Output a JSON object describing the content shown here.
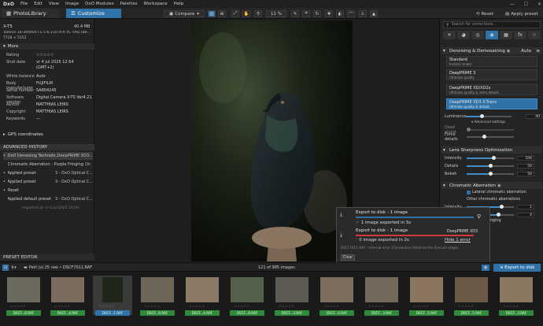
{
  "app": {
    "logo": "DxO",
    "menus": [
      "File",
      "Edit",
      "View",
      "Image",
      "DxO Modules",
      "Palettes",
      "Workspace",
      "Help"
    ]
  },
  "toolbar": {
    "tab_photolibrary": "PhotoLibrary",
    "tab_customize": "Customize",
    "compare_label": "Compare",
    "zoom_value": "11 %",
    "reset_label": "Reset",
    "apply_preset_label": "Apply preset"
  },
  "info": {
    "camera_line1": "X-T5",
    "file_size": "40.4 MB",
    "lens_line": "Tamron 18-300mm F3.5-6.3 Di III-A VC VXD (B0...",
    "dimensions": "7728 × 5152",
    "more_label": "More",
    "rows": [
      {
        "k": "Rating",
        "v": "☆☆☆☆☆"
      },
      {
        "k": "Shot date",
        "v": "vr 4 jul 2025 12:54"
      },
      {
        "k": "",
        "v": "(GMT+2)"
      },
      {
        "k": "White balance",
        "v": "Auto"
      },
      {
        "k": "Body manufacturer",
        "v": "FUJIFILM"
      },
      {
        "k": "Serial number",
        "v": "5A804245"
      },
      {
        "k": "Software version",
        "v": "Digital Camera X-T5 Ver4.21"
      },
      {
        "k": "Author",
        "v": "MATTHIAS LEIRS"
      },
      {
        "k": "Copyright",
        "v": "MATTHIAS LEIRS"
      },
      {
        "k": "Keywords",
        "v": "—"
      }
    ],
    "gps_label": "GPS coordinates"
  },
  "history": {
    "title": "ADVANCED HISTORY",
    "items": [
      {
        "n": "DxO Denoising Technolo...",
        "d": "DeepPRIME XD3..."
      },
      {
        "n": "Chromatic Aberration - Purple Fringing",
        "d": "On"
      },
      {
        "n": "Applied preset",
        "d": "3 - DxO Optical C..."
      },
      {
        "n": "Applied preset",
        "d": "3 - DxO Optical C..."
      },
      {
        "n": "Reset",
        "d": ""
      },
      {
        "n": "Applied default preset",
        "d": "3 - DxO Optical C..."
      }
    ],
    "imported": "Imported on vr 4 jul 2025 23:00"
  },
  "right": {
    "search_placeholder": "Search for corrections...",
    "denoise": {
      "title": "Denoising & Demosaicing",
      "auto": "Auto",
      "options": [
        {
          "t": "Standard",
          "s": "Instant render"
        },
        {
          "t": "DeepPRIME 3",
          "s": "Ultimate quality"
        },
        {
          "t": "DeepPRIME XD/XD2s",
          "s": "Ultimate quality & extra details"
        },
        {
          "t": "DeepPRIME XD3 X-Trans",
          "s": "Ultimate quality & details"
        }
      ],
      "luminance_label": "Luminance",
      "luminance_value": "40",
      "advanced_label": "Advanced settings",
      "dead_pixels_label": "Dead pixels",
      "force_details_label": "Force details"
    },
    "lens": {
      "title": "Lens Sharpness Optimization",
      "rows": [
        {
          "lbl": "Intensity",
          "val": "100",
          "frac": 0.55
        },
        {
          "lbl": "Details",
          "val": "50",
          "frac": 0.5
        },
        {
          "lbl": "Bokeh",
          "val": "50",
          "frac": 0.5
        }
      ]
    },
    "chroma": {
      "title": "Chromatic Aberration",
      "lateral": "Lateral chromatic aberration",
      "other": "Other chromatic aberrations",
      "intensity_label": "Intensity",
      "intensity_value": "1",
      "size_value": "4",
      "fringing_partial": "nging"
    }
  },
  "export": {
    "job1_title": "Export to disk - 1 image",
    "job1_status": "1 image exported in 5s",
    "job2_title": "Export to disk - 1 image",
    "job2_engine": "DeepPRIME XD3",
    "job2_status": "0 image exported in 2s",
    "job2_error": "Hide 1 error",
    "job2_detail": "DSCF7011.RAF : Internal error (Connection failed on the Execute stage)",
    "clear_label": "Clear"
  },
  "bottom": {
    "preset_editor": "PRESET EDITOR",
    "breadcrumb": "Peiri jul 25 raw  •  DSCF7011.RAF",
    "count": "121 of 985 images",
    "export_label": "Export to disk",
    "thumbs": [
      "DSCF...6.RAF",
      "DSCF...4.RAF",
      "DSCF...1.RAF",
      "DSCF...9.RAF",
      "DSCF...4.RAF",
      "DSCF...8.RAF",
      "DSCF...3.RAF",
      "DSCF...0.RAF",
      "DSCF...3.RAF",
      "DSCF...5.RAF",
      "DSCF...5.RAF",
      "DSCF...3.RAF"
    ]
  },
  "colors": {
    "accent": "#2f72a8",
    "ok": "#2f8a3a",
    "error": "#d23a3a"
  }
}
